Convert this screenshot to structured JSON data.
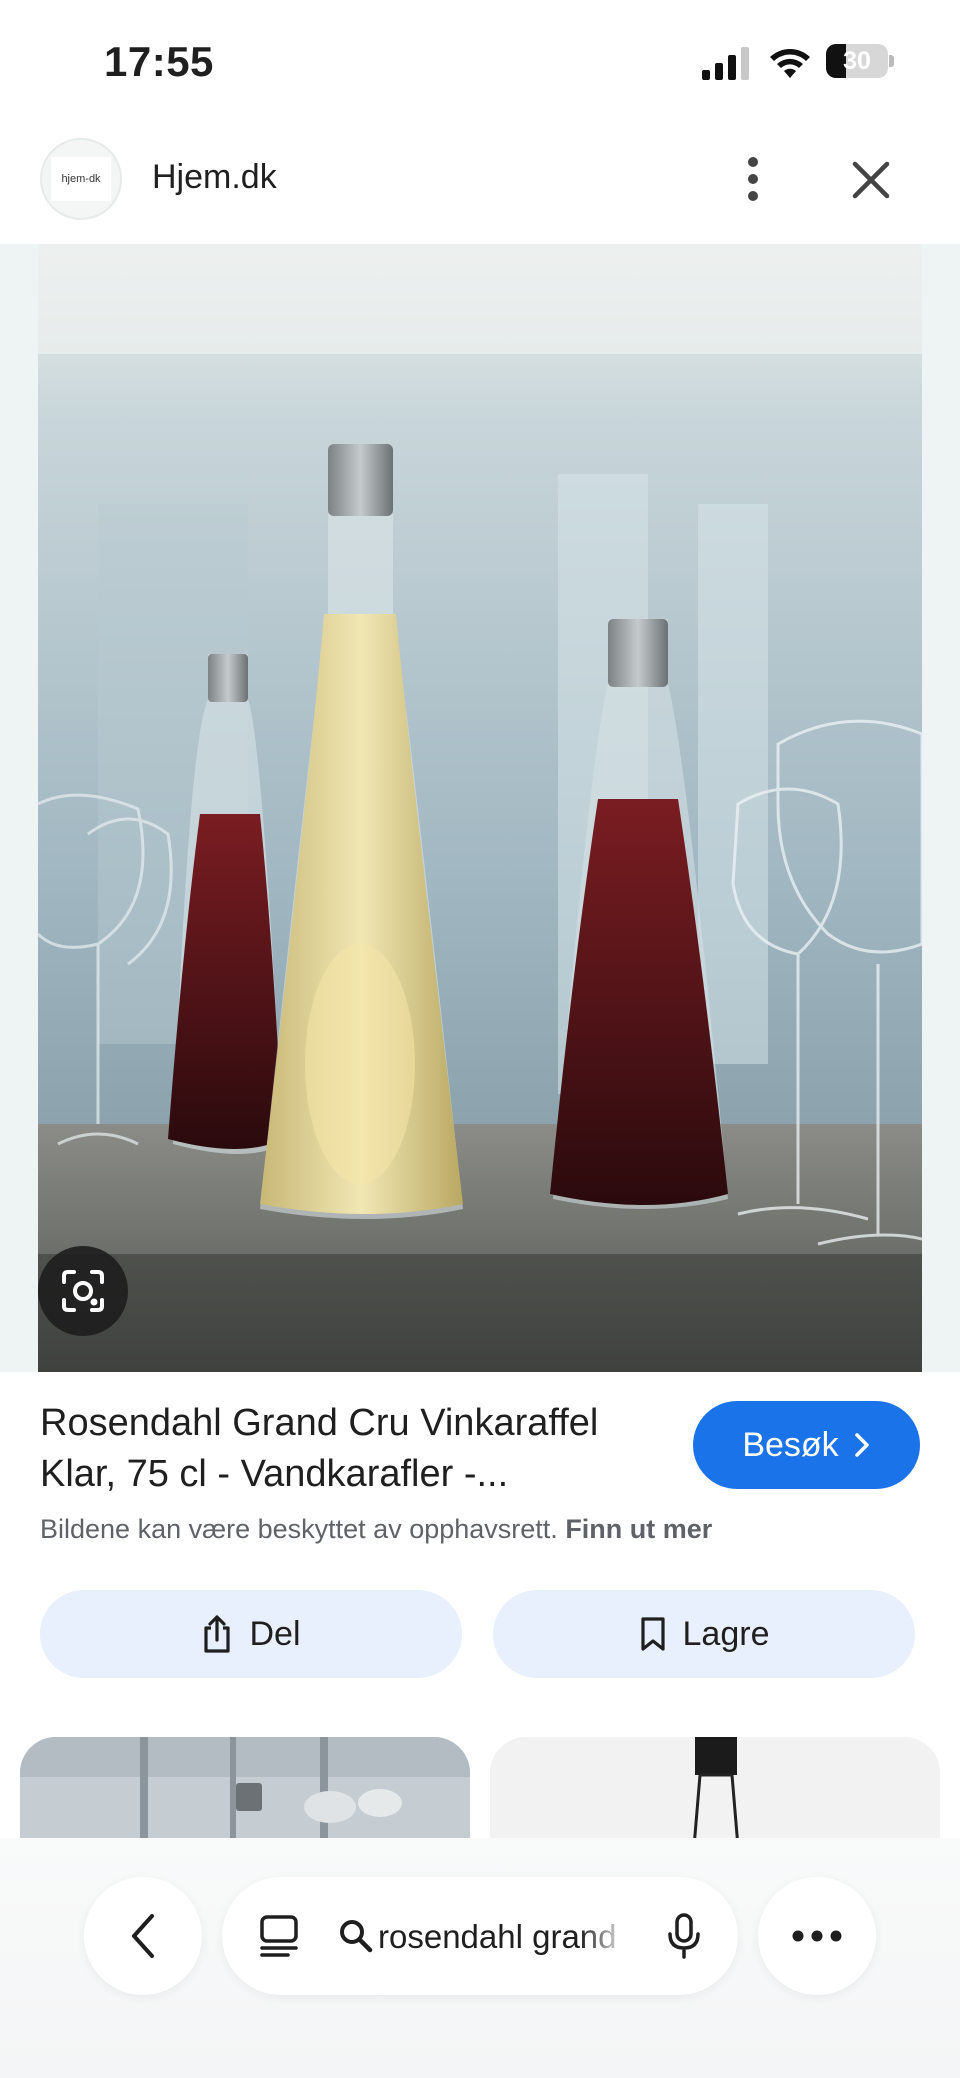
{
  "status_bar": {
    "time": "17:55",
    "battery": "30"
  },
  "header": {
    "logo_text": "hjem-dk",
    "site_name": "Hjem.dk"
  },
  "result": {
    "title": "Rosendahl Grand Cru Vinkaraffel Klar, 75 cl - Vandkarafler -...",
    "visit_label": "Besøk",
    "copyright_text": "Bildene kan være beskyttet av opphavsrett.",
    "learn_more": "Finn ut mer",
    "share_label": "Del",
    "save_label": "Lagre"
  },
  "search": {
    "query": "rosendahl grand"
  },
  "colors": {
    "accent": "#1a73e8",
    "pill_bg": "#e8effd",
    "text": "#1f1f1f",
    "muted": "#5f6368"
  },
  "icons": [
    "signal-icon",
    "wifi-icon",
    "battery-icon",
    "more-vert-icon",
    "close-icon",
    "lens-icon",
    "chevron-right-icon",
    "share-icon",
    "bookmark-icon",
    "back-icon",
    "tabs-icon",
    "search-icon",
    "mic-icon",
    "more-horiz-icon"
  ]
}
